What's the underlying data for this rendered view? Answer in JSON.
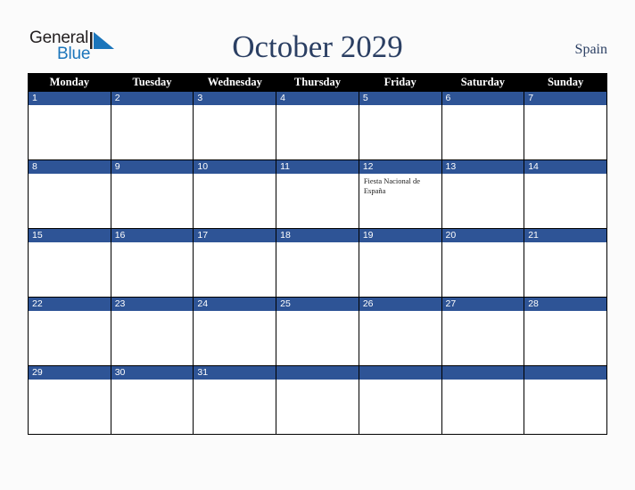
{
  "brand": {
    "name_part1": "General",
    "name_part2": "Blue",
    "triangle_color": "#1b75bb",
    "text_color": "#231f20"
  },
  "header": {
    "title": "October 2029",
    "country": "Spain",
    "title_color": "#2b3f63"
  },
  "colors": {
    "header_bar": "#000000",
    "day_number_bar": "#2e5496",
    "page_background": "#fbfbfb",
    "cell_background": "#ffffff",
    "grid_line": "#000000"
  },
  "calendar": {
    "month": "October",
    "year": "2029",
    "weekday_headers": [
      "Monday",
      "Tuesday",
      "Wednesday",
      "Thursday",
      "Friday",
      "Saturday",
      "Sunday"
    ],
    "weeks": [
      [
        {
          "day": "1",
          "events": []
        },
        {
          "day": "2",
          "events": []
        },
        {
          "day": "3",
          "events": []
        },
        {
          "day": "4",
          "events": []
        },
        {
          "day": "5",
          "events": []
        },
        {
          "day": "6",
          "events": []
        },
        {
          "day": "7",
          "events": []
        }
      ],
      [
        {
          "day": "8",
          "events": []
        },
        {
          "day": "9",
          "events": []
        },
        {
          "day": "10",
          "events": []
        },
        {
          "day": "11",
          "events": []
        },
        {
          "day": "12",
          "events": [
            "Fiesta Nacional de España"
          ]
        },
        {
          "day": "13",
          "events": []
        },
        {
          "day": "14",
          "events": []
        }
      ],
      [
        {
          "day": "15",
          "events": []
        },
        {
          "day": "16",
          "events": []
        },
        {
          "day": "17",
          "events": []
        },
        {
          "day": "18",
          "events": []
        },
        {
          "day": "19",
          "events": []
        },
        {
          "day": "20",
          "events": []
        },
        {
          "day": "21",
          "events": []
        }
      ],
      [
        {
          "day": "22",
          "events": []
        },
        {
          "day": "23",
          "events": []
        },
        {
          "day": "24",
          "events": []
        },
        {
          "day": "25",
          "events": []
        },
        {
          "day": "26",
          "events": []
        },
        {
          "day": "27",
          "events": []
        },
        {
          "day": "28",
          "events": []
        }
      ],
      [
        {
          "day": "29",
          "events": []
        },
        {
          "day": "30",
          "events": []
        },
        {
          "day": "31",
          "events": []
        },
        {
          "day": "",
          "events": []
        },
        {
          "day": "",
          "events": []
        },
        {
          "day": "",
          "events": []
        },
        {
          "day": "",
          "events": []
        }
      ]
    ]
  }
}
